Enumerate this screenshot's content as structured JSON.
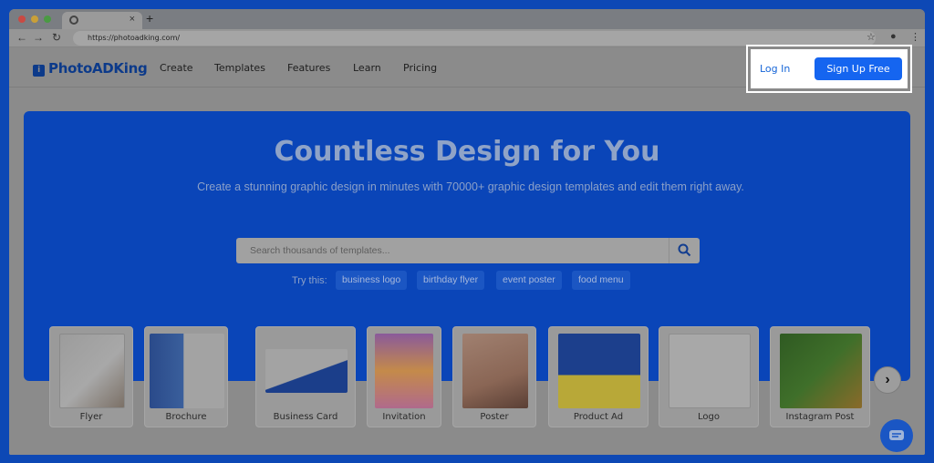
{
  "browser": {
    "tab_close": "×",
    "new_tab": "+",
    "url": "https://photoadking.com/"
  },
  "site": {
    "logo_text": "PhotoADKing",
    "nav": [
      "Create",
      "Templates",
      "Features",
      "Learn",
      "Pricing"
    ],
    "login": "Log In",
    "signup": "Sign Up Free"
  },
  "hero": {
    "title": "Countless Design for You",
    "subtitle": "Create a stunning graphic design in minutes with 70000+ graphic design templates and edit them right away.",
    "search_placeholder": "Search thousands of templates...",
    "try_label": "Try this:",
    "chips": [
      "business logo",
      "birthday flyer",
      "event poster",
      "food menu"
    ]
  },
  "categories": [
    "Flyer",
    "Brochure",
    "Business Card",
    "Invitation",
    "Poster",
    "Product Ad",
    "Logo",
    "Instagram Post"
  ],
  "icons": {
    "back": "back-arrow-icon",
    "forward": "forward-arrow-icon",
    "reload": "reload-icon",
    "search": "search-icon",
    "next": "chevron-right-icon",
    "chat": "chat-icon"
  },
  "colors": {
    "brand_blue": "#1565f0",
    "hero_blue": "#0a45b8",
    "frame_blue": "#0d48b5"
  }
}
